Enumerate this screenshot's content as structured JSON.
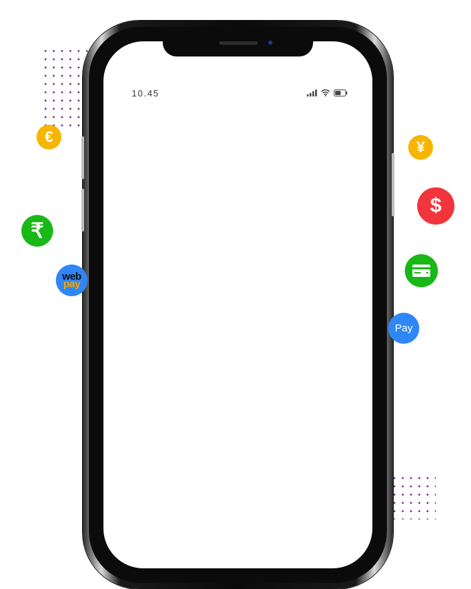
{
  "status_bar": {
    "time": "10.45",
    "icons": [
      "signal-icon",
      "wifi-icon",
      "battery-icon"
    ]
  },
  "floating_icons": {
    "euro": "€",
    "rupee": "₹",
    "webpay": {
      "line1": "web",
      "line2": "pay"
    },
    "yen": "¥",
    "dollar": "$",
    "card": "card-icon",
    "pay": "Pay"
  },
  "colors": {
    "yellow": "#f7b500",
    "green": "#19b816",
    "red": "#f2343b",
    "blue": "#2f86f6",
    "dots": "#7a2a8c"
  }
}
